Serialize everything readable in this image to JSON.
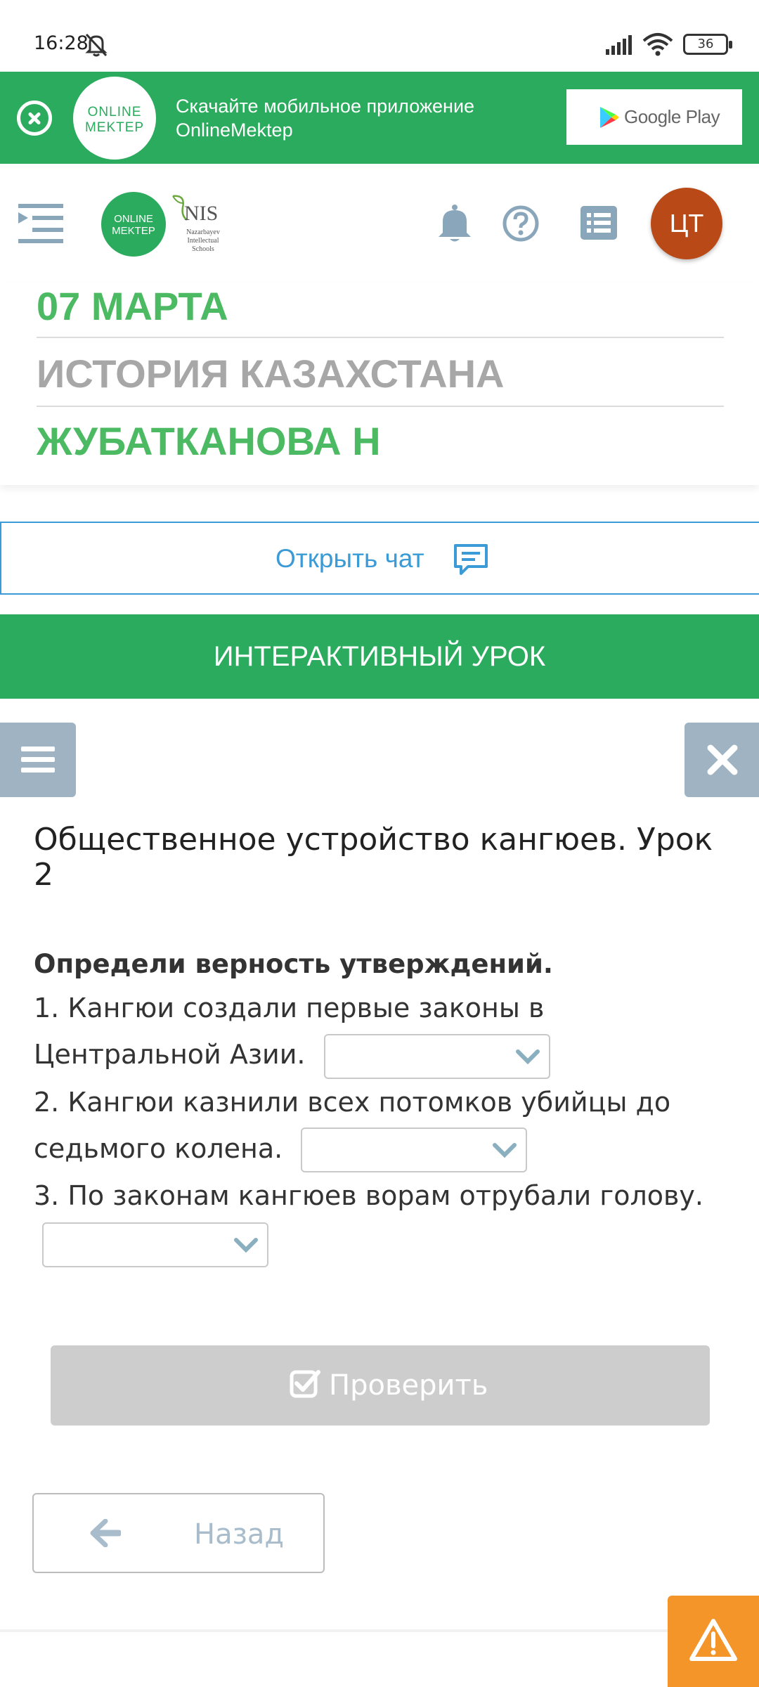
{
  "status_bar": {
    "time": "16:28",
    "battery": "36"
  },
  "banner": {
    "logo_line1": "ONLINE",
    "logo_line2": "MEKTEP",
    "text_line1": "Скачайте мобильное приложение",
    "text_line2": "OnlineMektep",
    "store_label": "Google Play"
  },
  "header": {
    "logo_line1": "ONLINE",
    "logo_line2": "MEKTEP",
    "nis_name": "NIS",
    "nis_sub": "Nazarbayev Intellectual Schools",
    "avatar_initials": "ЦТ"
  },
  "info": {
    "date": "07 МАРТА",
    "subject": "ИСТОРИЯ КАЗАХСТАНА",
    "teacher": "ЖУБАТКАНОВА Н"
  },
  "chat": {
    "label": "Открыть чат"
  },
  "section": {
    "title": "ИНТЕРАКТИВНЫЙ УРОК"
  },
  "lesson": {
    "title": "Общественное устройство кангюев. Урок 2",
    "instruction": "Определи верность утверждений.",
    "questions": [
      {
        "text": "1. Кангюи создали первые законы в Центральной Азии.",
        "value": ""
      },
      {
        "text": "2. Кангюи казнили всех потомков убийцы до седьмого колена.",
        "value": ""
      },
      {
        "text": "3. По законам кангюев ворам отрубали голову.",
        "value": ""
      }
    ]
  },
  "actions": {
    "check_label": "Проверить",
    "back_label": "Назад"
  },
  "colors": {
    "brand_green": "#2bab5e",
    "info_green": "#4cb963",
    "link_blue": "#3b9bd6",
    "avatar": "#b94a17",
    "warning": "#f4952a"
  },
  "icons": [
    "muted-bell-icon",
    "signal-icon",
    "wifi-icon",
    "battery-icon",
    "close-circle-icon",
    "google-play-icon",
    "menu-expand-icon",
    "bell-icon",
    "help-icon",
    "list-icon",
    "chat-icon",
    "hamburger-icon",
    "close-icon",
    "chevron-down-icon",
    "checkbox-icon",
    "arrow-left-icon",
    "warning-icon"
  ]
}
